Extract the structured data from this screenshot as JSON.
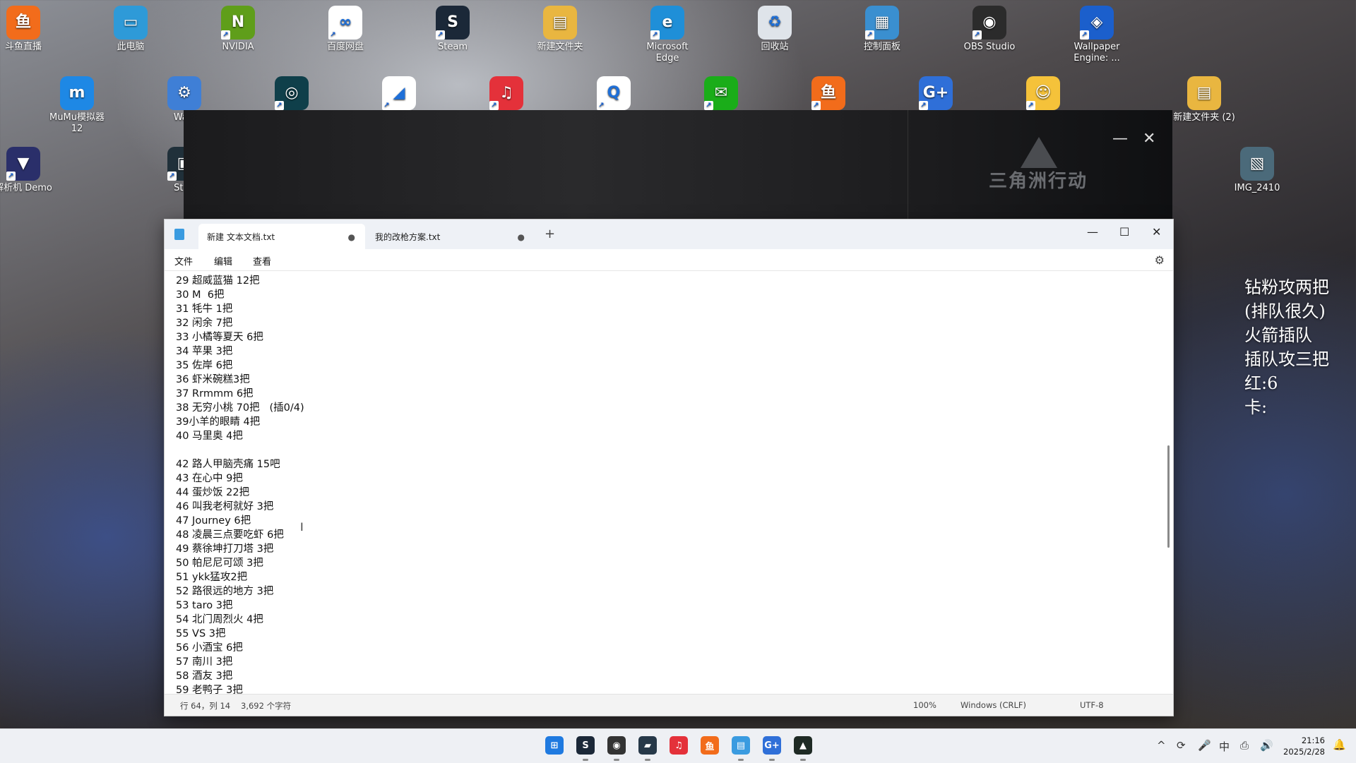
{
  "desktop": {
    "icons": [
      {
        "label": "斗鱼直播",
        "glyph": "鱼",
        "color": "#f26c1b",
        "arrow": false
      },
      {
        "label": "此电脑",
        "glyph": "▭",
        "color": "#2e9ad8",
        "arrow": false
      },
      {
        "label": "NVIDIA",
        "glyph": "N",
        "color": "#5f9e1a",
        "arrow": true
      },
      {
        "label": "百度网盘",
        "glyph": "∞",
        "color": "#ffffff",
        "arrow": true
      },
      {
        "label": "Steam",
        "glyph": "S",
        "color": "#1b2838",
        "arrow": true
      },
      {
        "label": "新建文件夹",
        "glyph": "▤",
        "color": "#e9b640",
        "arrow": false
      },
      {
        "label": "Microsoft Edge",
        "glyph": "e",
        "color": "#1f8fd8",
        "arrow": true
      },
      {
        "label": "回收站",
        "glyph": "♻",
        "color": "#dfe4ea",
        "arrow": false
      },
      {
        "label": "控制面板",
        "glyph": "▦",
        "color": "#3a8fd0",
        "arrow": true
      },
      {
        "label": "OBS Studio",
        "glyph": "◉",
        "color": "#2b2b2b",
        "arrow": true
      },
      {
        "label": "Wallpaper Engine: ...",
        "glyph": "◈",
        "color": "#1b5fcc",
        "arrow": true
      },
      {
        "label": "MuMu模拟器12",
        "glyph": "m",
        "color": "#1e88e5",
        "arrow": false
      },
      {
        "label": "Watt",
        "glyph": "⚙",
        "color": "#3f7fd6",
        "arrow": false
      },
      {
        "label": "",
        "glyph": "◎",
        "color": "#0f3f4a",
        "arrow": true
      },
      {
        "label": "",
        "glyph": "◢",
        "color": "#ffffff",
        "arrow": true
      },
      {
        "label": "",
        "glyph": "♫",
        "color": "#e4313a",
        "arrow": true
      },
      {
        "label": "",
        "glyph": "Q",
        "color": "#ffffff",
        "arrow": true
      },
      {
        "label": "",
        "glyph": "✉",
        "color": "#1aad19",
        "arrow": true
      },
      {
        "label": "",
        "glyph": "鱼",
        "color": "#f26c1b",
        "arrow": true
      },
      {
        "label": "",
        "glyph": "G+",
        "color": "#2f6fd8",
        "arrow": true
      },
      {
        "label": "",
        "glyph": "☺",
        "color": "#f5c23a",
        "arrow": true
      },
      {
        "label": "新建文件夹 (2)",
        "glyph": "▤",
        "color": "#e9b640",
        "arrow": false
      },
      {
        "label": "解析机 Demo",
        "glyph": "▼",
        "color": "#2a2f6a",
        "arrow": true
      },
      {
        "label": "Stud",
        "glyph": "▣",
        "color": "#20303a",
        "arrow": true
      },
      {
        "label": "IMG_2410",
        "glyph": "▧",
        "color": "#4b6a7a",
        "arrow": false
      }
    ]
  },
  "video_window": {
    "minimize": "—",
    "close": "✕",
    "logo_text": "三角洲行动"
  },
  "notepad": {
    "tabs": [
      {
        "label": "新建 文本文档.txt",
        "modified_dot": "●"
      },
      {
        "label": "我的改枪方案.txt",
        "modified_dot": "●"
      }
    ],
    "new_tab": "+",
    "controls": {
      "minimize": "—",
      "maximize": "☐",
      "close": "✕"
    },
    "menu": [
      "文件",
      "编辑",
      "查看"
    ],
    "settings_icon": "⚙",
    "lines": [
      "29 超威蓝猫 12把",
      "30 M  6把",
      "31 牦牛 1把",
      "32 闲余 7把",
      "33 小橘等夏天 6把",
      "34 苹果 3把",
      "35 佐岸 6把",
      "36 虾米碗糕3把",
      "37 Rrmmm 6把",
      "38 无穷小桃 70把   (插0/4)",
      "39小羊的眼睛 4把",
      "40 马里奥 4把",
      "",
      "42 路人甲脑壳痛 15吧",
      "43 在心中 9把",
      "44 蛋炒饭 22把",
      "46 叫我老柯就好 3把",
      "47 Journey 6把",
      "48 凌晨三点要吃虾 6把",
      "49 蔡徐坤打刀塔 3把",
      "50 帕尼尼可颂 3把",
      "51 ykk猛攻2把",
      "52 路很远的地方 3把",
      "53 taro 3把",
      "54 北门周烈火 4把",
      "55 VS 3把",
      "56 小酒宝 6把",
      "57 南川 3把",
      "58 酒友 3把",
      "59 老鸭子 3把"
    ],
    "status": {
      "position": "行 64，列 14",
      "chars": "3,692 个字符",
      "zoom": "100%",
      "line_ending": "Windows (CRLF)",
      "encoding": "UTF-8"
    }
  },
  "side_note": [
    "钻粉攻两把",
    "(排队很久)",
    "火箭插队",
    "插队攻三把",
    "红:6",
    "卡:"
  ],
  "taskbar": {
    "apps": [
      {
        "name": "start",
        "glyph": "⊞",
        "color": "#1f7ae0",
        "running": false
      },
      {
        "name": "steam",
        "glyph": "S",
        "color": "#1b2838",
        "running": true
      },
      {
        "name": "obs",
        "glyph": "◉",
        "color": "#333333",
        "running": true
      },
      {
        "name": "terminal",
        "glyph": "▰",
        "color": "#263848",
        "running": true
      },
      {
        "name": "netease",
        "glyph": "♫",
        "color": "#e4313a",
        "running": false
      },
      {
        "name": "douyu",
        "glyph": "鱼",
        "color": "#f26c1b",
        "running": false
      },
      {
        "name": "notepad",
        "glyph": "▤",
        "color": "#3a9be0",
        "running": true
      },
      {
        "name": "gplus",
        "glyph": "G+",
        "color": "#2f6fd8",
        "running": true
      },
      {
        "name": "delta",
        "glyph": "▲",
        "color": "#1e2a24",
        "running": true
      }
    ],
    "tray": [
      "^",
      "⟳",
      "🎤",
      "中",
      "⎙",
      "🔊"
    ],
    "time": "21:16",
    "date": "2025/2/28",
    "bell": "🔔"
  }
}
